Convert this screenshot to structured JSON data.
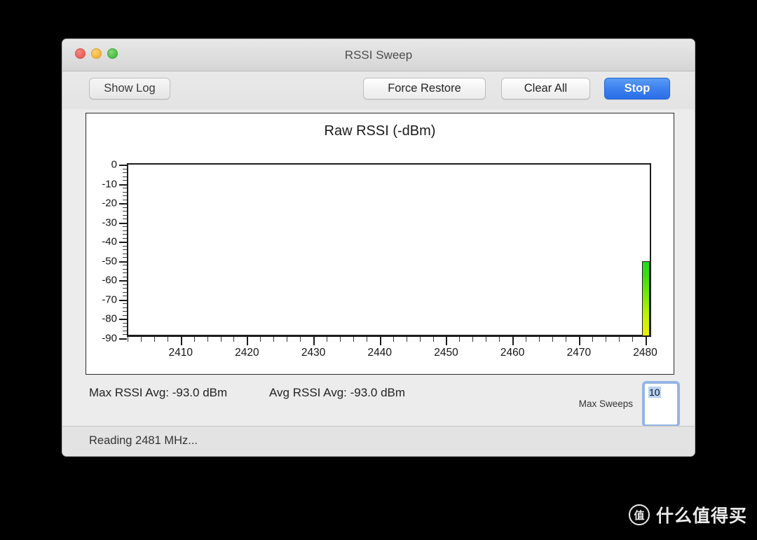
{
  "window": {
    "title": "RSSI Sweep",
    "traffic_lights": [
      "close-button",
      "minimize-button",
      "maximize-button"
    ]
  },
  "toolbar": {
    "show_log_label": "Show Log",
    "force_restore_label": "Force Restore",
    "clear_all_label": "Clear All",
    "stop_label": "Stop",
    "stop_color": "#3d80ef"
  },
  "stats": {
    "max_rssi": "Max RSSI Avg: -93.0 dBm",
    "avg_rssi": "Avg RSSI Avg: -93.0 dBm",
    "max_sweeps_label": "Max Sweeps",
    "max_sweeps_value": "10"
  },
  "status": {
    "text": "Reading 2481 MHz..."
  },
  "watermark": {
    "badge": "值",
    "text": "什么值得买"
  },
  "chart_data": {
    "type": "bar",
    "title": "Raw RSSI (-dBm)",
    "xlabel": "",
    "ylabel": "",
    "grid": false,
    "legend": "none",
    "xlim": [
      2402,
      2481
    ],
    "ylim": [
      -90,
      0
    ],
    "ytick_labels": [
      "0",
      "-10",
      "-20",
      "-30",
      "-40",
      "-50",
      "-60",
      "-70",
      "-80",
      "-90"
    ],
    "ytick_values": [
      0,
      -10,
      -20,
      -30,
      -40,
      -50,
      -60,
      -70,
      -80,
      -90
    ],
    "yminor_step": 2,
    "xtick_labels": [
      "2410",
      "2420",
      "2430",
      "2440",
      "2450",
      "2460",
      "2470",
      "2480"
    ],
    "xtick_values": [
      2410,
      2420,
      2430,
      2440,
      2450,
      2460,
      2470,
      2480
    ],
    "xminor_step": 2,
    "bar_gradient": [
      "#22dd22",
      "#eeee00"
    ],
    "bar_top_value": 0,
    "series": [
      {
        "name": "Raw RSSI",
        "x": [
          2403,
          2404,
          2405,
          2406,
          2407,
          2408,
          2409,
          2410,
          2411,
          2412,
          2413,
          2414,
          2415,
          2416,
          2417,
          2418,
          2419,
          2420,
          2421,
          2422,
          2423,
          2424,
          2425,
          2426,
          2427,
          2428,
          2429,
          2430,
          2431,
          2432,
          2433,
          2434,
          2435,
          2436,
          2437,
          2438,
          2439,
          2440,
          2441,
          2442,
          2443,
          2444,
          2445,
          2446,
          2447,
          2448,
          2449,
          2450,
          2451,
          2452,
          2453,
          2454,
          2455,
          2456,
          2457,
          2458,
          2459,
          2460,
          2461,
          2462,
          2463,
          2464,
          2465,
          2466,
          2467,
          2468,
          2469,
          2470,
          2471,
          2472,
          2473,
          2474,
          2475,
          2476,
          2477,
          2478,
          2479,
          2480
        ],
        "values": [
          -90,
          -90,
          -90,
          -90,
          -90,
          -90,
          -90,
          -90,
          -90,
          -90,
          -90,
          -90,
          -90,
          -90,
          -90,
          -90,
          -90,
          -90,
          -90,
          -90,
          -90,
          -90,
          -90,
          -90,
          -90,
          -90,
          -90,
          -90,
          -90,
          -90,
          -90,
          -90,
          -90,
          -90,
          -90,
          -90,
          -90,
          -90,
          -90,
          -90,
          -90,
          -90,
          -90,
          -90,
          -90,
          -90,
          -90,
          -90,
          -90,
          -90,
          -90,
          -90,
          -90,
          -90,
          -90,
          -90,
          -90,
          -90,
          -90,
          -90,
          -90,
          -90,
          -90,
          -90,
          -90,
          -90,
          -90,
          -90,
          -90,
          -90,
          -90,
          -90,
          -90,
          -90,
          -90,
          -90,
          -90,
          -51
        ]
      }
    ]
  }
}
